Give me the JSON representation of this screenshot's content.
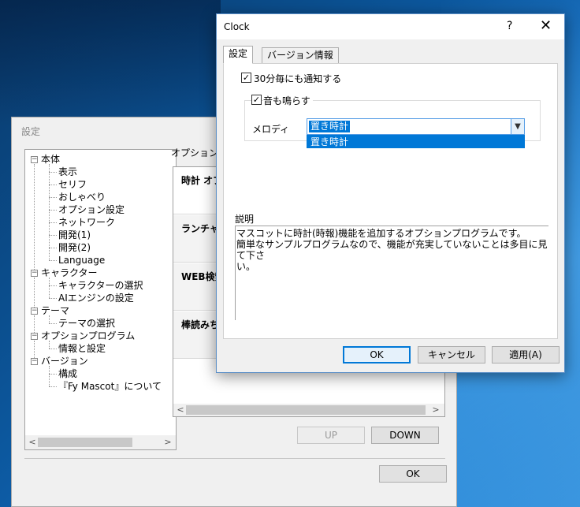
{
  "settings_window": {
    "title": "設定",
    "tree": [
      {
        "label": "本体",
        "level": 0,
        "expander": "−"
      },
      {
        "label": "表示",
        "level": 1
      },
      {
        "label": "セリフ",
        "level": 1
      },
      {
        "label": "おしゃべり",
        "level": 1
      },
      {
        "label": "オプション設定",
        "level": 1
      },
      {
        "label": "ネットワーク",
        "level": 1
      },
      {
        "label": "開発(1)",
        "level": 1
      },
      {
        "label": "開発(2)",
        "level": 1
      },
      {
        "label": "Language",
        "level": 1
      },
      {
        "label": "キャラクター",
        "level": 0,
        "expander": "−"
      },
      {
        "label": "キャラクターの選択",
        "level": 1
      },
      {
        "label": "AIエンジンの設定",
        "level": 1
      },
      {
        "label": "テーマ",
        "level": 0,
        "expander": "−"
      },
      {
        "label": "テーマの選択",
        "level": 1
      },
      {
        "label": "オプションプログラム",
        "level": 0,
        "expander": "−"
      },
      {
        "label": "情報と設定",
        "level": 1
      },
      {
        "label": "バージョン",
        "level": 0,
        "expander": "−"
      },
      {
        "label": "構成",
        "level": 1
      },
      {
        "label": "『Fy Mascot』について",
        "level": 1
      }
    ],
    "group_label": "オプションプ",
    "list_items": [
      "時計 オプ",
      "ランチャー",
      "WEB検索",
      "棒読みち"
    ],
    "up_button": "UP",
    "down_button": "DOWN",
    "ok_button": "OK"
  },
  "clock_dialog": {
    "title": "Clock",
    "help_glyph": "?",
    "close_glyph": "✕",
    "tabs": [
      "設定",
      "バージョン情報"
    ],
    "checkbox_30min": {
      "label": "30分毎にも通知する",
      "checked": true
    },
    "checkbox_sound": {
      "label": "音も鳴らす",
      "checked": true
    },
    "melody_label": "メロディ",
    "melody_selected": "置き時計",
    "melody_options": [
      "置き時計"
    ],
    "description_label": "説明",
    "description_lines": [
      "マスコットに時計(時報)機能を追加するオプションプログラムです。",
      "簡単なサンプルプログラムなので、機能が充実していないことは多目に見て下さ",
      "い。"
    ],
    "ok_button": "OK",
    "cancel_button": "キャンセル",
    "apply_button": "適用(A)"
  },
  "colors": {
    "accent": "#0078d7",
    "desktop": "#0e62b0"
  }
}
